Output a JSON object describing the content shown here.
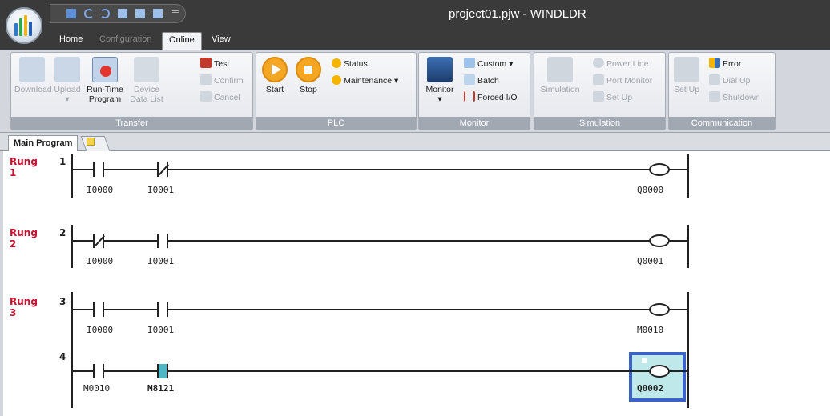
{
  "window": {
    "title": "project01.pjw - WINDLDR"
  },
  "tabs": [
    {
      "label": "Home",
      "state": "normal"
    },
    {
      "label": "Configuration",
      "state": "disabled"
    },
    {
      "label": "Online",
      "state": "active"
    },
    {
      "label": "View",
      "state": "normal"
    }
  ],
  "ribbon": {
    "transfer": {
      "label": "Transfer",
      "download": "Download",
      "upload": "Upload",
      "runtime": [
        "Run-Time",
        "Program"
      ],
      "device": [
        "Device",
        "Data List"
      ],
      "test": "Test",
      "confirm": "Confirm",
      "cancel": "Cancel"
    },
    "plc": {
      "label": "PLC",
      "start": "Start",
      "stop": "Stop",
      "status": "Status",
      "maintenance": "Maintenance"
    },
    "monitor": {
      "label": "Monitor",
      "monitor": "Monitor",
      "custom": "Custom",
      "batch": "Batch",
      "forced_io": "Forced I/O"
    },
    "simulation": {
      "label": "Simulation",
      "simulation": "Simulation",
      "power_line": "Power Line",
      "port_monitor": "Port Monitor",
      "set_up": "Set Up"
    },
    "communication": {
      "label": "Communication",
      "set_up": "Set Up",
      "error": "Error",
      "dial_up": "Dial Up",
      "shutdown": "Shutdown"
    }
  },
  "doc_tabs": {
    "main": "Main Program"
  },
  "ladder": {
    "rung_word": "Rung",
    "rungs": [
      {
        "number": "1",
        "line": "1",
        "contact1": "I0000",
        "contact2": "I0001",
        "coil": "Q0000"
      },
      {
        "number": "2",
        "line": "2",
        "contact1": "I0000",
        "contact2": "I0001",
        "coil": "Q0001"
      },
      {
        "number": "3",
        "line": "3",
        "contact1": "I0000",
        "contact2": "I0001",
        "coil": "M0010"
      },
      {
        "number": "",
        "line": "4",
        "contact1": "M0010",
        "contact2": "M8121",
        "coil": "Q0002"
      }
    ]
  },
  "colors": {
    "rung_label": "#c8102e",
    "selection_border": "#3b62c9",
    "highlight": "#4fb6c6"
  }
}
